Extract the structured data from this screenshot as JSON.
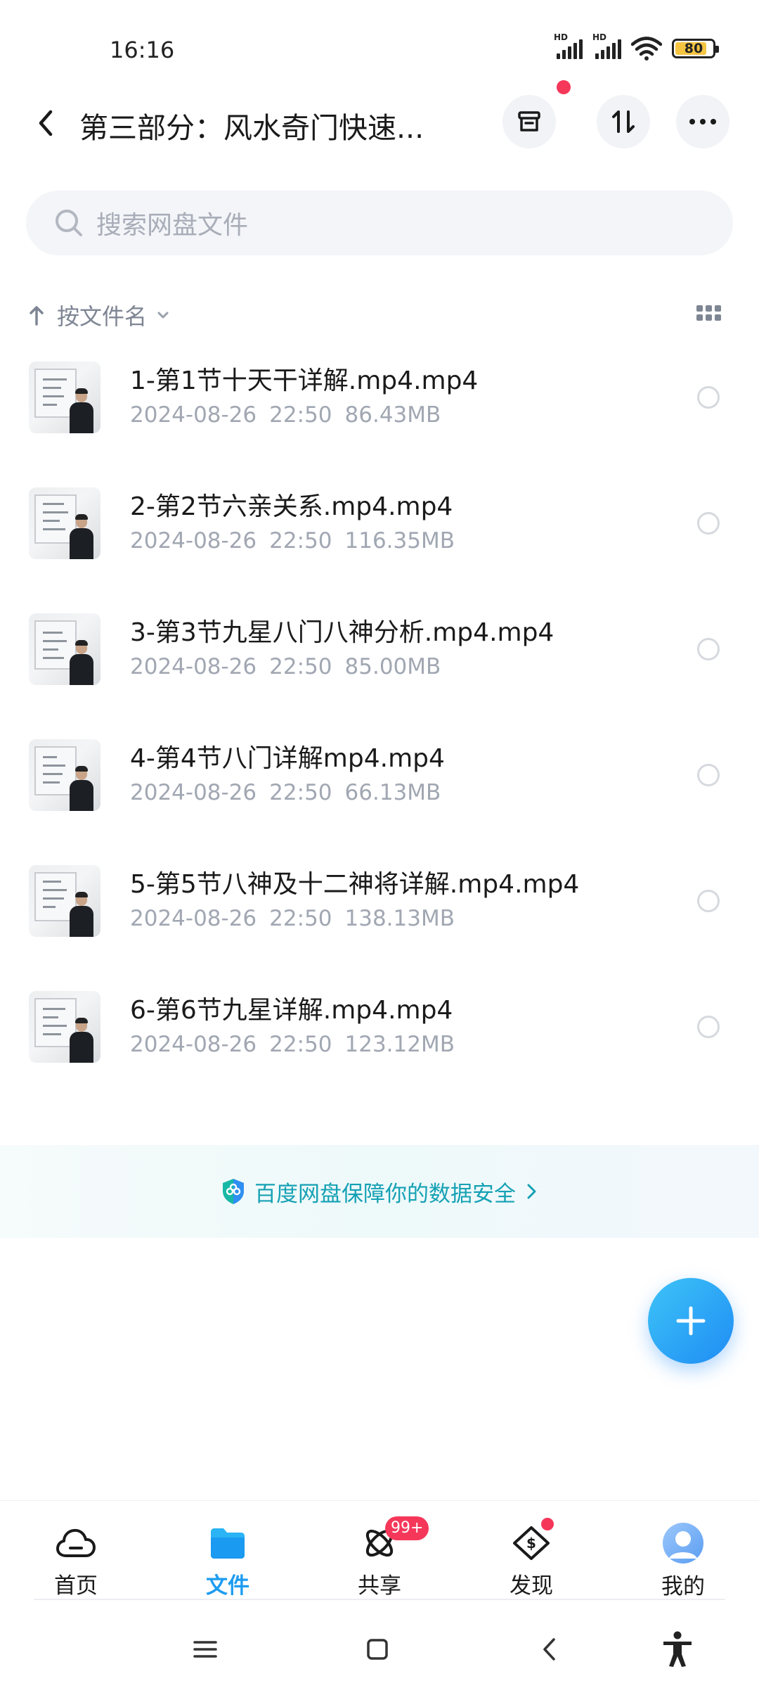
{
  "status_bar": {
    "time": "16:16",
    "battery": "80",
    "signal_label_1": "HD",
    "signal_label_2": "HD"
  },
  "header": {
    "title": "第三部分：风水奇门快速...",
    "buttons": [
      "archive-icon",
      "transfer-icon",
      "more-icon"
    ]
  },
  "search": {
    "placeholder": "搜索网盘文件"
  },
  "sort": {
    "label": "按文件名"
  },
  "files": [
    {
      "name": "1-第1节十天干详解.mp4.mp4",
      "date": "2024-08-26",
      "time": "22:50",
      "size": "86.43MB"
    },
    {
      "name": "2-第2节六亲关系.mp4.mp4",
      "date": "2024-08-26",
      "time": "22:50",
      "size": "116.35MB"
    },
    {
      "name": "3-第3节九星八门八神分析.mp4.mp4",
      "date": "2024-08-26",
      "time": "22:50",
      "size": "85.00MB"
    },
    {
      "name": "4-第4节八门详解mp4.mp4",
      "date": "2024-08-26",
      "time": "22:50",
      "size": "66.13MB"
    },
    {
      "name": "5-第5节八神及十二神将详解.mp4.mp4",
      "date": "2024-08-26",
      "time": "22:50",
      "size": "138.13MB"
    },
    {
      "name": "6-第6节九星详解.mp4.mp4",
      "date": "2024-08-26",
      "time": "22:50",
      "size": "123.12MB"
    }
  ],
  "security_banner": {
    "text": "百度网盘保障你的数据安全"
  },
  "bottom_nav": {
    "items": [
      {
        "label": "首页",
        "icon": "cloud-icon"
      },
      {
        "label": "文件",
        "icon": "folder-icon",
        "active": true
      },
      {
        "label": "共享",
        "icon": "share-atom-icon",
        "badge": "99+"
      },
      {
        "label": "发现",
        "icon": "discover-icon"
      },
      {
        "label": "我的",
        "icon": "avatar-icon"
      }
    ]
  },
  "colors": {
    "accent": "#1d9cf0",
    "badge": "#f5375a",
    "banner_text": "#15a1b4"
  }
}
